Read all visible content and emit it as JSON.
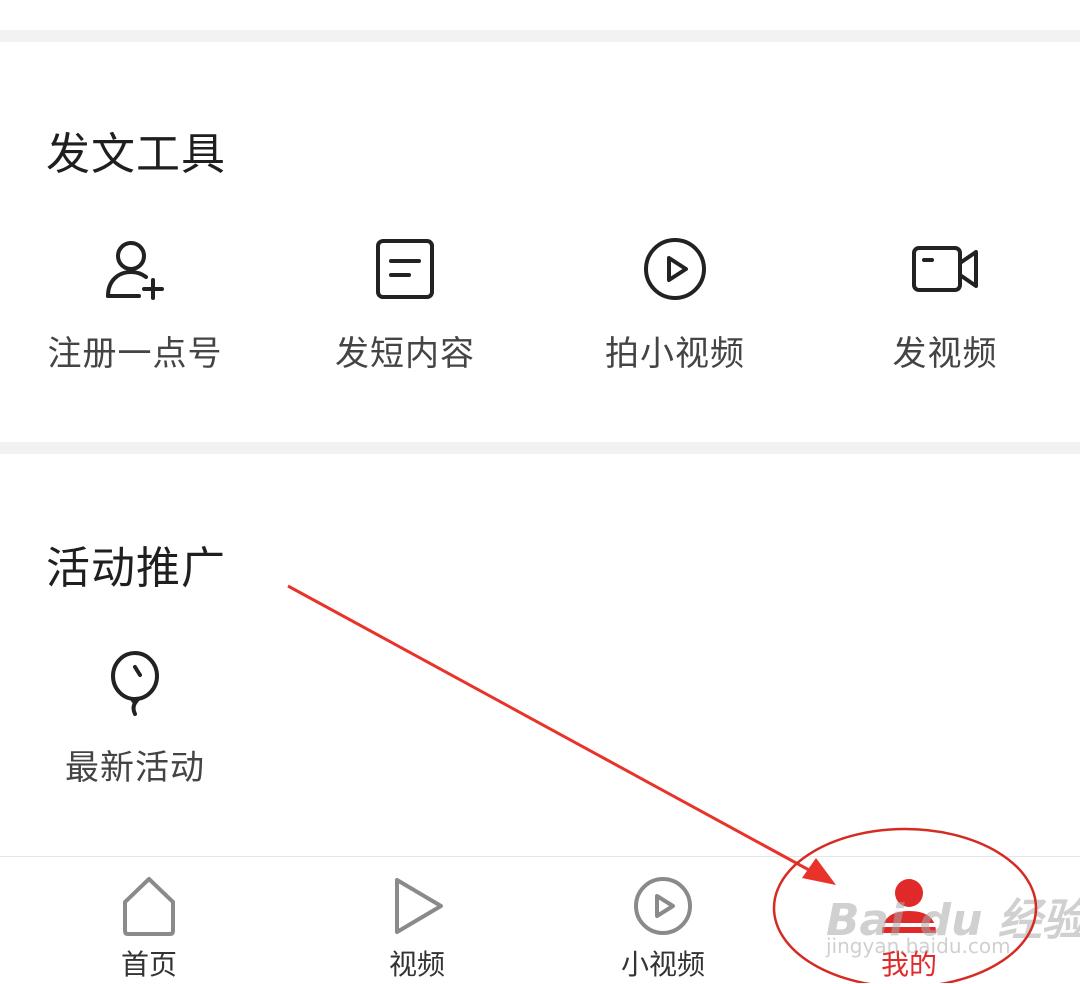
{
  "sections": {
    "tools": {
      "title": "发文工具",
      "items": [
        {
          "label": "注册一点号",
          "icon": "user-add-icon"
        },
        {
          "label": "发短内容",
          "icon": "document-icon"
        },
        {
          "label": "拍小视频",
          "icon": "play-circle-icon"
        },
        {
          "label": "发视频",
          "icon": "video-camera-icon"
        }
      ]
    },
    "promo": {
      "title": "活动推广",
      "items": [
        {
          "label": "最新活动",
          "icon": "balloon-icon"
        }
      ]
    }
  },
  "bottom_nav": {
    "items": [
      {
        "label": "首页",
        "icon": "home-icon",
        "active": false
      },
      {
        "label": "视频",
        "icon": "play-triangle-icon",
        "active": false
      },
      {
        "label": "小视频",
        "icon": "play-circle-icon",
        "active": false
      },
      {
        "label": "我的",
        "icon": "profile-icon",
        "active": true
      }
    ]
  },
  "watermark": {
    "brand": "Bai du 经验",
    "url": "jingyan.baidu.com"
  },
  "colors": {
    "accent": "#e02929",
    "annotation": "#e8322a",
    "divider": "#f2f2f2"
  }
}
